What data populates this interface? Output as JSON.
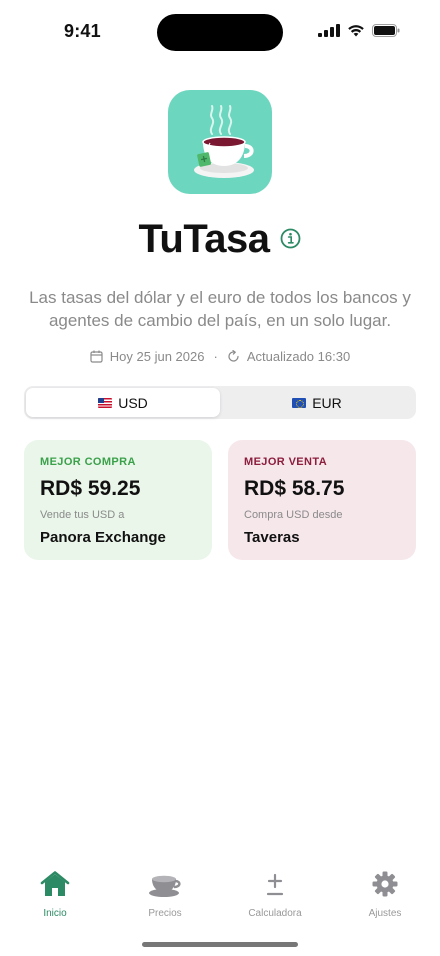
{
  "status_bar": {
    "time": "9:41",
    "icons": [
      "signal-icon",
      "wifi-icon",
      "battery-icon"
    ]
  },
  "app": {
    "icon": "tea-cup-icon",
    "title": "TuTasa",
    "subtitle": "Las tasas del dólar y el euro de todos los bancos y agentes de cambio del país, en un solo lugar.",
    "date": "Hoy 25 jun 2026",
    "separator": "·",
    "updated": "Actualizado 16:30"
  },
  "currency_selector": {
    "options": [
      {
        "label": "USD",
        "flag": "flag-us-icon",
        "selected": true
      },
      {
        "label": "EUR",
        "flag": "flag-eu-icon",
        "selected": false
      }
    ]
  },
  "best_buy": {
    "label": "MEJOR COMPRA",
    "value": "RD$ 59.25",
    "caption": "Vende tus USD a",
    "name": "Panora Exchange"
  },
  "best_sell": {
    "label": "MEJOR VENTA",
    "value": "RD$ 58.75",
    "caption": "Compra USD desde",
    "name": "Taveras"
  },
  "tab_bar": {
    "tabs": [
      {
        "label": "Inicio",
        "icon": "home-icon",
        "active": true
      },
      {
        "label": "Precios",
        "icon": "cup-icon",
        "active": false
      },
      {
        "label": "Calculadora",
        "icon": "plus-minus-icon",
        "active": false
      },
      {
        "label": "Ajustes",
        "icon": "gear-icon",
        "active": false
      }
    ]
  },
  "colors": {
    "accent": "#2c8a64",
    "icon_background": "#6cd6bf",
    "buy_card": "#eaf6ea",
    "sell_card": "#f6e7eb",
    "buy_label": "#3aa14a",
    "sell_label": "#8c1d3d"
  }
}
